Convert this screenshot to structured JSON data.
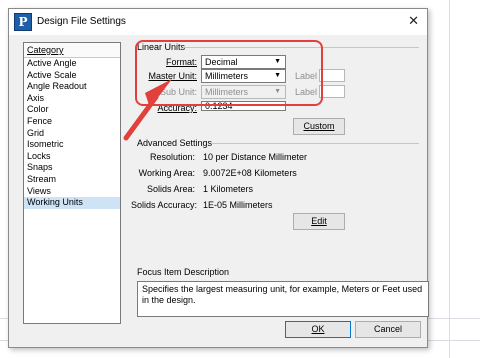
{
  "dialog": {
    "title": "Design File Settings",
    "close_glyph": "✕",
    "icon": "app-icon",
    "icon_glyph": "P"
  },
  "category": {
    "header": "Category",
    "items": [
      "Active Angle",
      "Active Scale",
      "Angle Readout",
      "Axis",
      "Color",
      "Fence",
      "Grid",
      "Isometric",
      "Locks",
      "Snaps",
      "Stream",
      "Views",
      "Working Units"
    ],
    "selected": "Working Units"
  },
  "linear_units": {
    "title": "Linear Units",
    "format_label": "Format:",
    "format_value": "Decimal",
    "master_unit_label": "Master Unit:",
    "master_unit_value": "Millimeters",
    "master_label_text": "Label",
    "sub_unit_label": "Sub Unit:",
    "sub_unit_value": "Millimeters",
    "sub_label_text": "Label",
    "accuracy_label": "Accuracy:",
    "accuracy_value": "0.1234",
    "custom_button": "Custom"
  },
  "advanced": {
    "title": "Advanced Settings",
    "resolution_label": "Resolution:",
    "resolution_value": "10 per Distance Millimeter",
    "working_area_label": "Working Area:",
    "working_area_value": "9.0072E+08 Kilometers",
    "solids_area_label": "Solids Area:",
    "solids_area_value": "1 Kilometers",
    "solids_accuracy_label": "Solids Accuracy:",
    "solids_accuracy_value": "1E-05 Millimeters",
    "edit_button": "Edit"
  },
  "focus": {
    "title": "Focus Item Description",
    "text": "Specifies the largest measuring unit, for example, Meters or Feet used in the design."
  },
  "footer": {
    "ok_button": "OK",
    "cancel_button": "Cancel"
  },
  "colors": {
    "annotation": "#e0413c",
    "selected_row": "#cfe3f7",
    "default_button_border": "#0078d7"
  }
}
